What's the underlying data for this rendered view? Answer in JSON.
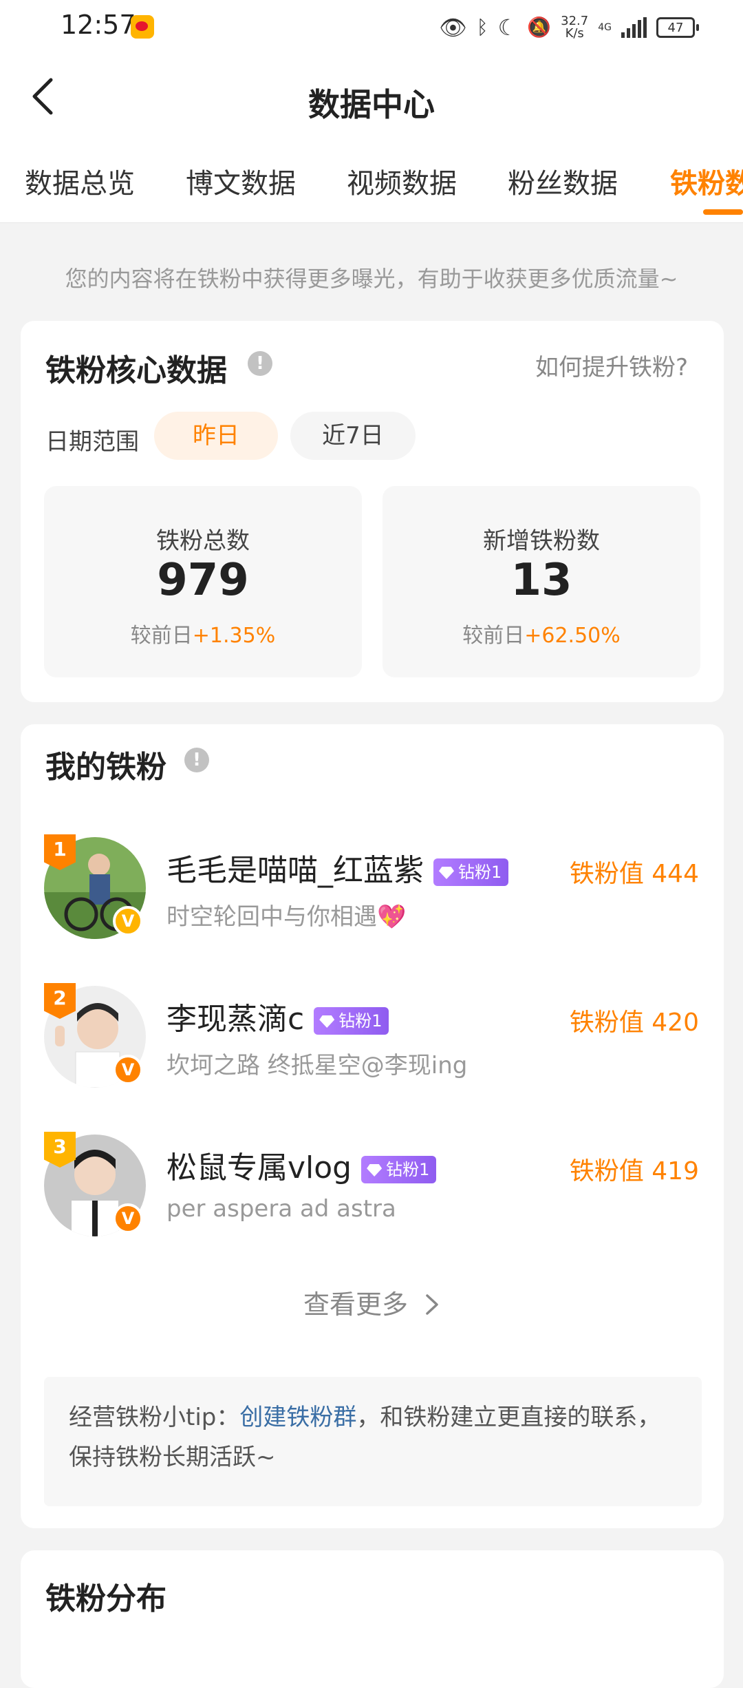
{
  "status_bar": {
    "time": "12:57",
    "net_speed": "32.7",
    "net_unit": "K/s",
    "network": "4G",
    "battery": "47",
    "icons": [
      "weibo-icon",
      "eye-icon",
      "bluetooth-icon",
      "moon-icon",
      "mute-icon",
      "signal-icon",
      "battery-icon"
    ]
  },
  "header": {
    "title": "数据中心"
  },
  "tabs": [
    {
      "label": "数据总览"
    },
    {
      "label": "博文数据"
    },
    {
      "label": "视频数据"
    },
    {
      "label": "粉丝数据"
    },
    {
      "label": "铁粉数据"
    }
  ],
  "notice": "您的内容将在铁粉中获得更多曝光，有助于收获更多优质流量~",
  "core": {
    "title": "铁粉核心数据",
    "howto": "如何提升铁粉?",
    "date_label": "日期范围",
    "range_yesterday": "昨日",
    "range_7days": "近7日",
    "total_label": "铁粉总数",
    "total_value": "979",
    "total_compare_prefix": "较前日",
    "total_compare_pct": "+1.35%",
    "new_label": "新增铁粉数",
    "new_value": "13",
    "new_compare_prefix": "较前日",
    "new_compare_pct": "+62.50%"
  },
  "fans": {
    "title": "我的铁粉",
    "items": [
      {
        "rank": "1",
        "name": "毛毛是喵喵_红蓝紫",
        "badge": "钻粉1",
        "desc": "时空轮回中与你相遇💖",
        "score": "铁粉值 444"
      },
      {
        "rank": "2",
        "name": "李现蒸滴c",
        "badge": "钻粉1",
        "desc": "坎坷之路 终抵星空@李现ing",
        "score": "铁粉值 420"
      },
      {
        "rank": "3",
        "name": "松鼠专属vlog",
        "badge": "钻粉1",
        "desc": "per aspera ad astra",
        "score": "铁粉值 419"
      }
    ],
    "more": "查看更多",
    "tip_prefix": "经营铁粉小tip：",
    "tip_link": "创建铁粉群",
    "tip_suffix": "，和铁粉建立更直接的联系，保持铁粉长期活跃~"
  },
  "distribution": {
    "title": "铁粉分布"
  },
  "colors": {
    "accent": "#ff8200",
    "link": "#3a6ea5",
    "badge": "#9b6af5"
  }
}
